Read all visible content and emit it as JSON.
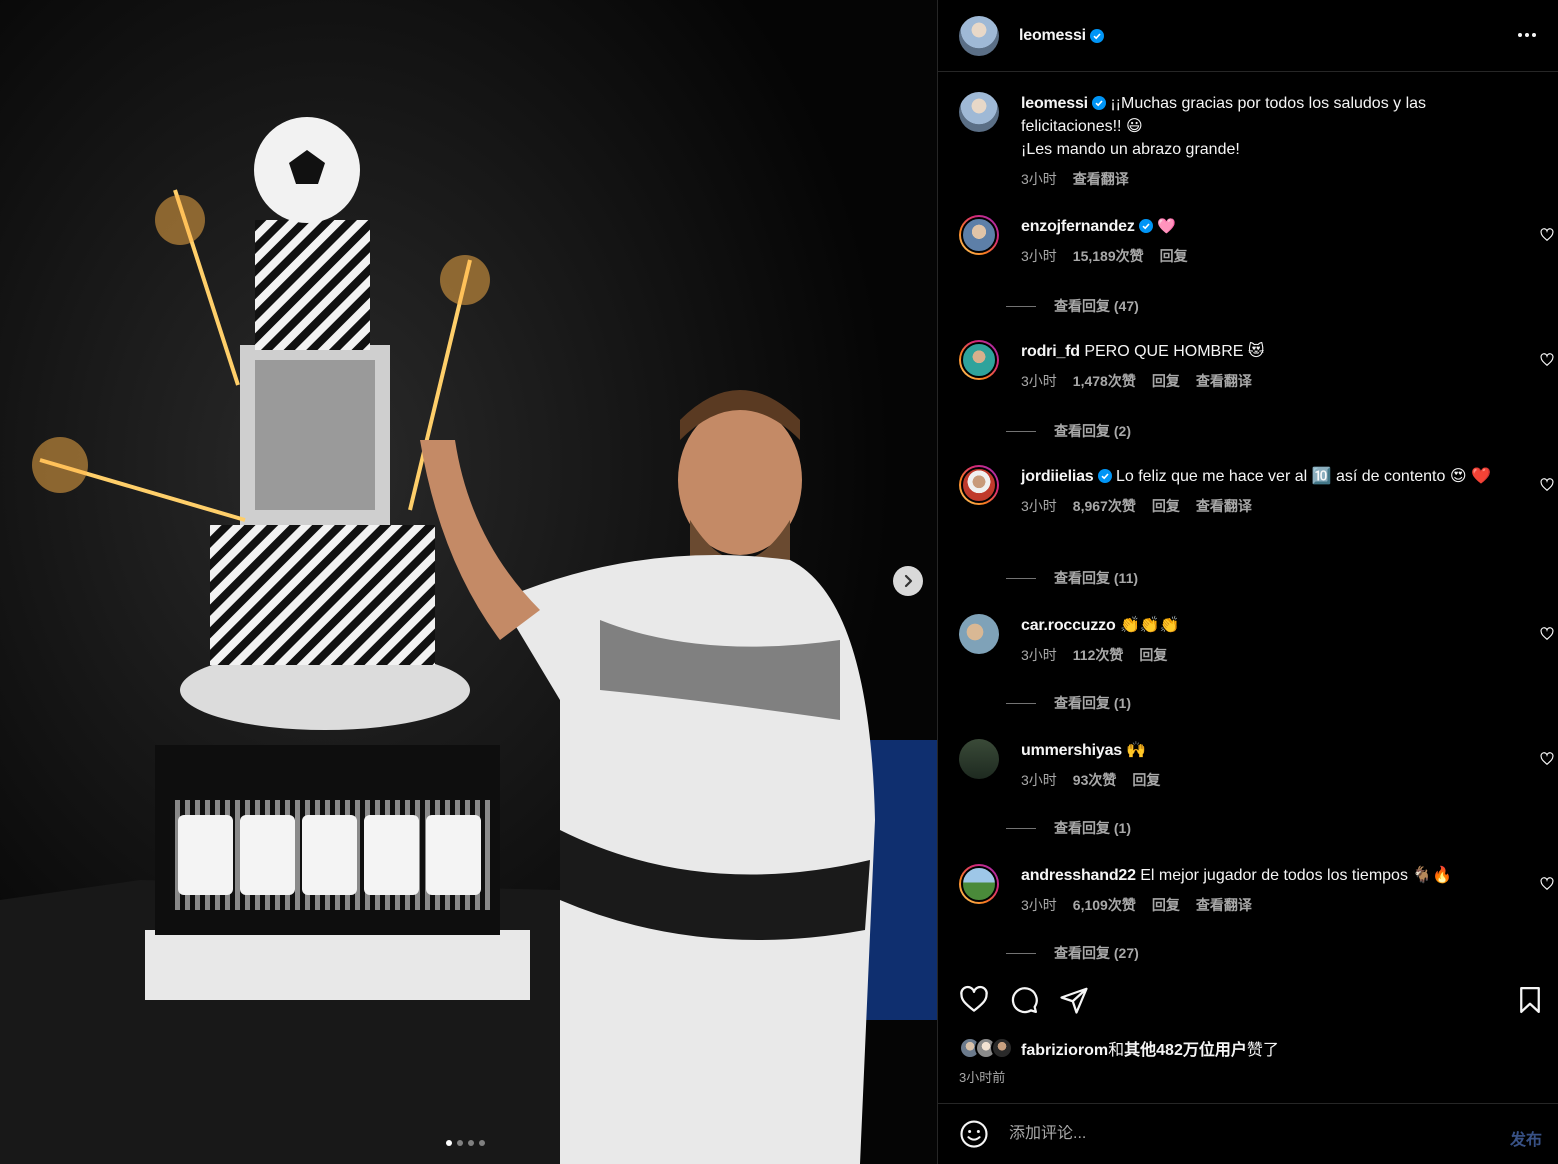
{
  "header": {
    "username": "leomessi",
    "more_icon": "more-horizontal-icon"
  },
  "caption": {
    "username": "leomessi",
    "text_line1": "¡¡Muchas gracias por todos los saludos y las felicitaciones!! 😃",
    "text_line2": "¡Les mando un abrazo grande!",
    "time": "3小时",
    "translate": "查看翻译"
  },
  "comments": [
    {
      "username": "enzojfernandez",
      "verified": true,
      "text": "🩷",
      "time": "3小时",
      "likes": "15,189次赞",
      "reply": "回复",
      "translate": "",
      "view_replies": "查看回复 (47)"
    },
    {
      "username": "rodri_fd",
      "verified": false,
      "text": "PERO QUE HOMBRE 😻",
      "time": "3小时",
      "likes": "1,478次赞",
      "reply": "回复",
      "translate": "查看翻译",
      "view_replies": "查看回复 (2)"
    },
    {
      "username": "jordiielias",
      "verified": true,
      "text": "Lo feliz que me hace ver al 🔟 así de contento 😍 ❤️",
      "time": "3小时",
      "likes": "8,967次赞",
      "reply": "回复",
      "translate": "查看翻译",
      "view_replies": "查看回复 (11)"
    },
    {
      "username": "car.roccuzzo",
      "verified": false,
      "text": "👏👏👏",
      "time": "3小时",
      "likes": "112次赞",
      "reply": "回复",
      "translate": "",
      "view_replies": "查看回复 (1)"
    },
    {
      "username": "ummershiyas",
      "verified": false,
      "text": "🙌",
      "time": "3小时",
      "likes": "93次赞",
      "reply": "回复",
      "translate": "",
      "view_replies": "查看回复 (1)"
    },
    {
      "username": "andresshand22",
      "verified": false,
      "text": "El mejor jugador de todos los tiempos 🐐🔥",
      "time": "3小时",
      "likes": "6,109次赞",
      "reply": "回复",
      "translate": "查看翻译",
      "view_replies": "查看回复 (27)"
    }
  ],
  "likes": {
    "user": "fabriziorom",
    "connector": "和",
    "others": "其他482万位用户",
    "suffix": "赞了"
  },
  "time_ago": "3小时前",
  "add_comment": {
    "placeholder": "添加评论...",
    "post_label": "发布"
  },
  "media": {
    "slide_index": 1,
    "slide_count": 4
  }
}
